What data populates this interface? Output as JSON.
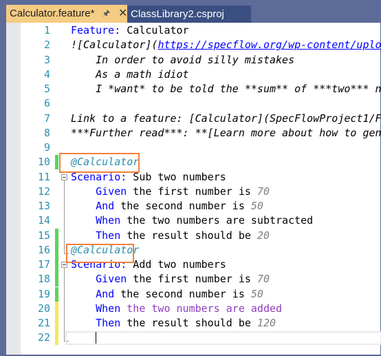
{
  "tabs": [
    {
      "label": "Calculator.feature*",
      "active": true,
      "pin_icon": "pin-icon",
      "close_icon": "close-icon"
    },
    {
      "label": "ClassLibrary2.csproj",
      "active": false
    }
  ],
  "colors": {
    "keyword": "#0000ff",
    "tag": "#2b91af",
    "number": "#808080",
    "unbound_step": "#8f3cbe",
    "highlight_box": "#f27f3d",
    "bound_bar": "#5ad65a",
    "pending_bar": "#f5e85a"
  },
  "lines": [
    {
      "n": "1",
      "bar": "",
      "tokens": [
        {
          "t": "Feature:",
          "c": "kw"
        },
        {
          "t": " Calculator",
          "c": "tx"
        }
      ]
    },
    {
      "n": "2",
      "bar": "",
      "tokens": [
        {
          "t": "![Calculator](",
          "c": "it"
        },
        {
          "t": "https://specflow.org/wp-content/uplo",
          "c": "link"
        }
      ]
    },
    {
      "n": "3",
      "bar": "",
      "tokens": [
        {
          "t": "    In order to avoid silly mistakes",
          "c": "it"
        }
      ]
    },
    {
      "n": "4",
      "bar": "",
      "tokens": [
        {
          "t": "    As a math idiot",
          "c": "it"
        }
      ]
    },
    {
      "n": "5",
      "bar": "",
      "tokens": [
        {
          "t": "    I *want* to be told the **sum** of ***two*** n",
          "c": "it"
        }
      ]
    },
    {
      "n": "6",
      "bar": "",
      "tokens": []
    },
    {
      "n": "7",
      "bar": "",
      "tokens": [
        {
          "t": "Link to a feature: [Calculator](SpecFlowProject1/F",
          "c": "it"
        }
      ]
    },
    {
      "n": "8",
      "bar": "",
      "tokens": [
        {
          "t": "***Further read***: **[Learn more about how to gen",
          "c": "it"
        }
      ]
    },
    {
      "n": "9",
      "bar": "",
      "tokens": []
    },
    {
      "n": "10",
      "bar": "green",
      "tokens": [
        {
          "t": "@Calculator",
          "c": "tag"
        }
      ]
    },
    {
      "n": "11",
      "bar": "",
      "tokens": [
        {
          "t": "Scenario:",
          "c": "kw"
        },
        {
          "t": " Sub two numbers",
          "c": "tx"
        }
      ]
    },
    {
      "n": "12",
      "bar": "",
      "tokens": [
        {
          "t": "    Given",
          "c": "kw"
        },
        {
          "t": " the first number is ",
          "c": "tx"
        },
        {
          "t": "70",
          "c": "num"
        }
      ]
    },
    {
      "n": "13",
      "bar": "",
      "tokens": [
        {
          "t": "    And",
          "c": "kw"
        },
        {
          "t": " the second number is ",
          "c": "tx"
        },
        {
          "t": "50",
          "c": "num"
        }
      ]
    },
    {
      "n": "14",
      "bar": "",
      "tokens": [
        {
          "t": "    When",
          "c": "kw"
        },
        {
          "t": " the two numbers are subtracted",
          "c": "tx"
        }
      ]
    },
    {
      "n": "15",
      "bar": "green",
      "tokens": [
        {
          "t": "    Then",
          "c": "kw"
        },
        {
          "t": " the result should be ",
          "c": "tx"
        },
        {
          "t": "20",
          "c": "num"
        }
      ]
    },
    {
      "n": "16",
      "bar": "green",
      "tokens": [
        {
          "t": "@Calculator",
          "c": "tag"
        }
      ]
    },
    {
      "n": "17",
      "bar": "green",
      "tokens": [
        {
          "t": "Scenario:",
          "c": "kw"
        },
        {
          "t": " Add two numbers",
          "c": "tx"
        }
      ]
    },
    {
      "n": "18",
      "bar": "green",
      "tokens": [
        {
          "t": "    Given",
          "c": "kw"
        },
        {
          "t": " the first number is ",
          "c": "tx"
        },
        {
          "t": "70",
          "c": "num"
        }
      ]
    },
    {
      "n": "19",
      "bar": "green",
      "tokens": [
        {
          "t": "    And",
          "c": "kw"
        },
        {
          "t": " the second number is ",
          "c": "tx"
        },
        {
          "t": "50",
          "c": "num"
        }
      ]
    },
    {
      "n": "20",
      "bar": "yellow",
      "tokens": [
        {
          "t": "    When",
          "c": "kw"
        },
        {
          "t": " the two numbers are added",
          "c": "unb"
        }
      ]
    },
    {
      "n": "21",
      "bar": "yellow",
      "tokens": [
        {
          "t": "    Then",
          "c": "kw"
        },
        {
          "t": " the result should be ",
          "c": "tx"
        },
        {
          "t": "120",
          "c": "num"
        }
      ]
    },
    {
      "n": "22",
      "bar": "yellow",
      "tokens": []
    }
  ]
}
